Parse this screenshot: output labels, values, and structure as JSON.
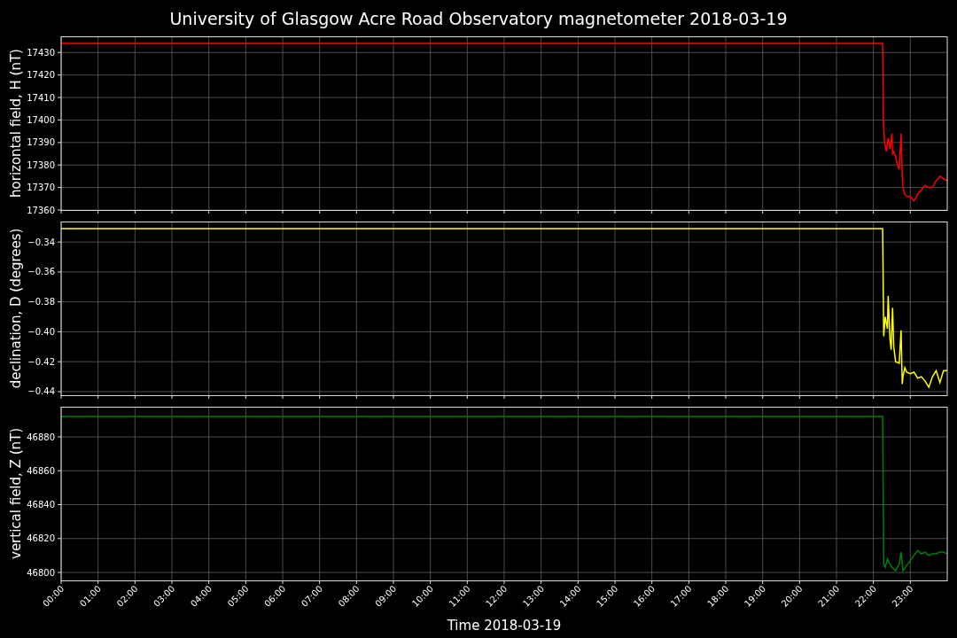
{
  "title": "University of Glasgow Acre Road Observatory magnetometer 2018-03-19",
  "panels": [
    {
      "chart_data": {
        "type": "line",
        "grid": true,
        "ylabel": "horizontal field, H (nT)",
        "xlim": [
          0,
          24
        ],
        "ylim": [
          17360,
          17437.2
        ],
        "yticks": [
          {
            "value": 17360,
            "label": "17360"
          },
          {
            "value": 17370,
            "label": "17370"
          },
          {
            "value": 17380,
            "label": "17380"
          },
          {
            "value": 17390,
            "label": "17390"
          },
          {
            "value": 17400,
            "label": "17400"
          },
          {
            "value": 17410,
            "label": "17410"
          },
          {
            "value": 17420,
            "label": "17420"
          },
          {
            "value": 17430,
            "label": "17430"
          }
        ],
        "x": [
          0,
          22.25,
          22.27,
          22.3,
          22.35,
          22.4,
          22.45,
          22.5,
          22.52,
          22.55,
          22.6,
          22.65,
          22.7,
          22.75,
          22.78,
          22.8,
          22.85,
          22.9,
          23.0,
          23.1,
          23.2,
          23.3,
          23.4,
          23.5,
          23.6,
          23.7,
          23.8,
          23.9,
          24
        ],
        "series": [
          {
            "color": "#ff0000",
            "values": [
              17434,
              17434,
              17400,
              17390,
              17386,
              17392,
              17387,
              17394,
              17385,
              17386,
              17384,
              17380,
              17378,
              17394,
              17375,
              17370,
              17367,
              17366,
              17366,
              17364,
              17367,
              17369,
              17371,
              17370,
              17370,
              17373,
              17375,
              17374,
              17373
            ]
          }
        ]
      }
    },
    {
      "chart_data": {
        "type": "line",
        "grid": true,
        "ylabel": "declination, D (degrees)",
        "xlim": [
          0,
          24
        ],
        "ylim": [
          -0.4424,
          -0.3263
        ],
        "yticks": [
          {
            "value": -0.44,
            "label": "−0.44"
          },
          {
            "value": -0.42,
            "label": "−0.42"
          },
          {
            "value": -0.4,
            "label": "−0.40"
          },
          {
            "value": -0.38,
            "label": "−0.38"
          },
          {
            "value": -0.36,
            "label": "−0.36"
          },
          {
            "value": -0.34,
            "label": "−0.34"
          }
        ],
        "x": [
          0,
          22.25,
          22.28,
          22.32,
          22.38,
          22.4,
          22.45,
          22.48,
          22.52,
          22.55,
          22.6,
          22.7,
          22.75,
          22.78,
          22.8,
          22.85,
          22.9,
          23.0,
          23.1,
          23.2,
          23.3,
          23.4,
          23.5,
          23.6,
          23.7,
          23.8,
          23.9,
          24
        ],
        "series": [
          {
            "color": "#ffff00",
            "values": [
              -0.331,
              -0.331,
              -0.403,
              -0.39,
              -0.398,
              -0.376,
              -0.405,
              -0.412,
              -0.384,
              -0.41,
              -0.42,
              -0.421,
              -0.399,
              -0.435,
              -0.43,
              -0.424,
              -0.427,
              -0.428,
              -0.427,
              -0.431,
              -0.43,
              -0.433,
              -0.437,
              -0.43,
              -0.426,
              -0.434,
              -0.426,
              -0.426
            ]
          }
        ]
      }
    },
    {
      "chart_data": {
        "type": "line",
        "grid": true,
        "ylabel": "vertical field, Z (nT)",
        "xlabel": "Time 2018-03-19",
        "xlim": [
          0,
          24
        ],
        "ylim": [
          46795.3,
          46897.8
        ],
        "xticks": [
          {
            "value": 0,
            "label": "00:00"
          },
          {
            "value": 1,
            "label": "01:00"
          },
          {
            "value": 2,
            "label": "02:00"
          },
          {
            "value": 3,
            "label": "03:00"
          },
          {
            "value": 4,
            "label": "04:00"
          },
          {
            "value": 5,
            "label": "05:00"
          },
          {
            "value": 6,
            "label": "06:00"
          },
          {
            "value": 7,
            "label": "07:00"
          },
          {
            "value": 8,
            "label": "08:00"
          },
          {
            "value": 9,
            "label": "09:00"
          },
          {
            "value": 10,
            "label": "10:00"
          },
          {
            "value": 11,
            "label": "11:00"
          },
          {
            "value": 12,
            "label": "12:00"
          },
          {
            "value": 13,
            "label": "13:00"
          },
          {
            "value": 14,
            "label": "14:00"
          },
          {
            "value": 15,
            "label": "15:00"
          },
          {
            "value": 16,
            "label": "16:00"
          },
          {
            "value": 17,
            "label": "17:00"
          },
          {
            "value": 18,
            "label": "18:00"
          },
          {
            "value": 19,
            "label": "19:00"
          },
          {
            "value": 20,
            "label": "20:00"
          },
          {
            "value": 21,
            "label": "21:00"
          },
          {
            "value": 22,
            "label": "22:00"
          },
          {
            "value": 23,
            "label": "23:00"
          }
        ],
        "yticks": [
          {
            "value": 46800,
            "label": "46800"
          },
          {
            "value": 46820,
            "label": "46820"
          },
          {
            "value": 46840,
            "label": "46840"
          },
          {
            "value": 46860,
            "label": "46860"
          },
          {
            "value": 46880,
            "label": "46880"
          }
        ],
        "x": [
          0,
          22.25,
          22.28,
          22.32,
          22.38,
          22.42,
          22.5,
          22.6,
          22.7,
          22.75,
          22.8,
          22.9,
          23.0,
          23.1,
          23.2,
          23.3,
          23.4,
          23.5,
          23.6,
          23.7,
          23.8,
          23.9,
          24
        ],
        "series": [
          {
            "color": "#008000",
            "values": [
              46892,
              46892,
              46805,
              46803,
              46808,
              46806,
              46803,
              46801,
              46805,
              46812,
              46801,
              46804,
              46807,
              46810,
              46813,
              46811,
              46812,
              46810,
              46811,
              46811,
              46812,
              46812,
              46811
            ]
          }
        ]
      }
    }
  ]
}
